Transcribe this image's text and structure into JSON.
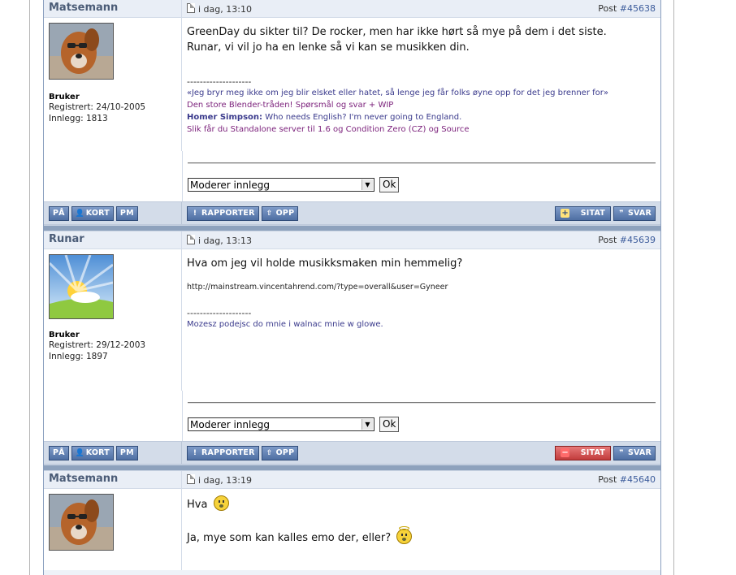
{
  "posts": [
    {
      "author": "Matsemann",
      "time": "i dag, 13:10",
      "post_label": "Post ",
      "post_no": "#45638",
      "rank": "Bruker",
      "registered": "Registrert: 24/10-2005",
      "posts_count": "Innlegg: 1813",
      "text_lines": [
        "GreenDay du sikter til? De rocker, men har ikke hørt så mye på dem i det siste.",
        "Runar, vi vil jo ha en lenke så vi kan se musikken din."
      ],
      "sig_sep": "--------------------",
      "sig_quote": "«Jeg bryr meg ikke om jeg blir elsket eller hatet, så lenge jeg får folks øyne opp for det jeg brenner for»",
      "sig_link1": "Den store Blender-tråden! Spørsmål og svar + WIP",
      "sig_homer_bold": "Homer Simpson:",
      "sig_homer_text": " Who needs English? I'm never going to England.",
      "sig_link2": "Slik får du Standalone server til 1.6 og Condition Zero (CZ) og Source"
    },
    {
      "author": "Runar",
      "time": "i dag, 13:13",
      "post_label": "Post ",
      "post_no": "#45639",
      "rank": "Bruker",
      "registered": "Registrert: 29/12-2003",
      "posts_count": "Innlegg: 1897",
      "text": "Hva om jeg vil holde musikksmaken min hemmelig?",
      "url": "http://mainstream.vincentahrend.com/?type=overall&user=Gyneer",
      "sig_sep": "--------------------",
      "sig": "Mozesz podejsc do mnie i walnac mnie w glowe."
    },
    {
      "author": "Matsemann",
      "time": "i dag, 13:19",
      "post_label": "Post ",
      "post_no": "#45640",
      "text1": "Hva",
      "text2": "Ja, mye som kan kalles emo der, eller?"
    }
  ],
  "moderate": {
    "select_value": "Moderer innlegg",
    "ok": "Ok"
  },
  "buttons": {
    "pa": "PÅ",
    "kort": "KORT",
    "pm": "PM",
    "rapporter": "RAPPORTER",
    "opp": "OPP",
    "sitat": "SITAT",
    "svar": "SVAR"
  },
  "icons": {
    "dog_avatar": "dog-with-sunglasses",
    "sun_avatar": "sun-sky",
    "doc": "document-icon",
    "smiley1": "surprised-smiley",
    "smiley2": "angel-smiley"
  }
}
